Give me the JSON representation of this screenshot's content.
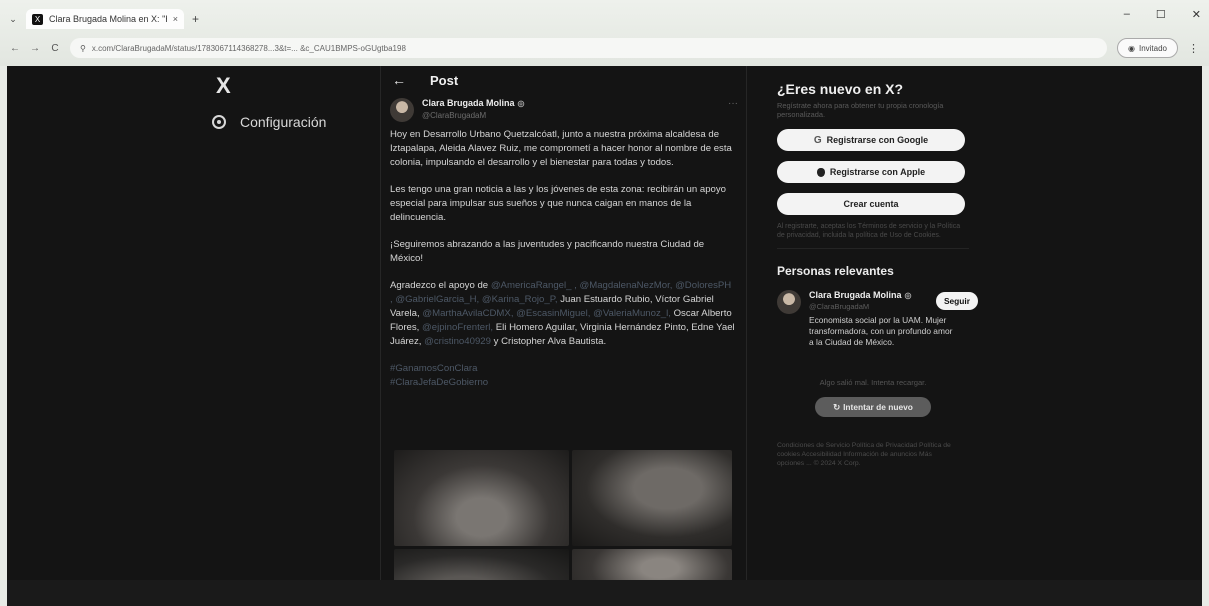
{
  "browser": {
    "tab_title": "Clara Brugada Molina en X: \"H...",
    "tab_close": "×",
    "new_tab": "+",
    "address": "x.com/ClaraBrugadaM/status/1783067114368278...3&t=... &c_CAU1BMPS-oGUgtba198",
    "incognito_label": "Invitado",
    "window_min": "–",
    "window_max": "☐",
    "window_close": "✕"
  },
  "left_nav": {
    "logo": "X",
    "items": [
      {
        "label": "Configuración"
      }
    ]
  },
  "post": {
    "header_title": "Post",
    "author_name": "Clara Brugada Molina",
    "author_handle": "@ClaraBrugadaM",
    "paragraph_1": "Hoy en Desarrollo Urbano Quetzalcóatl, junto a nuestra próxima alcaldesa de Iztapalapa, Aleida Alavez Ruiz, me comprometí a hacer honor al nombre de esta colonia, impulsando el desarrollo y el bienestar para todas y todos.",
    "paragraph_2": "Les tengo una gran noticia a las y los jóvenes de esta zona: recibirán un apoyo especial para impulsar sus sueños y que nunca caigan en manos de la delincuencia.",
    "paragraph_3": "¡Seguiremos abrazando a las juventudes y pacificando nuestra Ciudad de México!",
    "thanks_lead": "Agradezco el apoyo de ",
    "thanks_mentions_1": "@AmericaRangel_ , @MagdalenaNezMor, @DoloresPH , @GabrielGarcia_H, @Karina_Rojo_P,",
    "thanks_text_1": " Juan Estuardo Rubio, Víctor Gabriel Varela, ",
    "thanks_mentions_2": "@MarthaAvilaCDMX, @EscasinMiguel, @ValeriaMunoz_l,",
    "thanks_text_2": " Oscar Alberto Flores, ",
    "thanks_mentions_3": "@ejpinoFrenterl,",
    "thanks_text_3": " Eli Homero Aguilar, Virginia Hernández Pinto, Edne Yael Juárez, ",
    "thanks_mentions_4": "@cristino40929",
    "thanks_text_4": " y Cristopher Alva Bautista.",
    "hashtag_1": "#GanamosConClara",
    "hashtag_2": "#ClaraJefaDeGobierno"
  },
  "sidebar": {
    "signup_title": "¿Eres nuevo en X?",
    "signup_sub": "Regístrate ahora para obtener tu propia cronología personalizada.",
    "google_btn": "Registrarse con Google",
    "apple_btn": "Registrarse con Apple",
    "create_btn": "Crear cuenta",
    "legal": "Al registrarte, aceptas los Términos de servicio y la Política de privacidad, incluida la política de Uso de Cookies.",
    "relevant_title": "Personas relevantes",
    "person_name": "Clara Brugada Molina",
    "person_handle": "@ClaraBrugadaM",
    "person_bio": "Economista social por la UAM. Mujer transformadora, con un profundo amor a la Ciudad de México.",
    "follow_btn": "Seguir",
    "error_text": "Algo salió mal. Intenta recargar.",
    "retry_btn": "Intentar de nuevo",
    "footer": "Condiciones de Servicio   Política de Privacidad   Política de cookies   Accesibilidad   Información de anuncios   Más opciones ...   © 2024 X Corp."
  },
  "icons": {
    "back": "←",
    "more": "···",
    "verified": "◎",
    "google": "G",
    "retry": "↻",
    "reload": "C",
    "fwd": "→",
    "menu": "⋮",
    "tab_menu": "⌄"
  }
}
